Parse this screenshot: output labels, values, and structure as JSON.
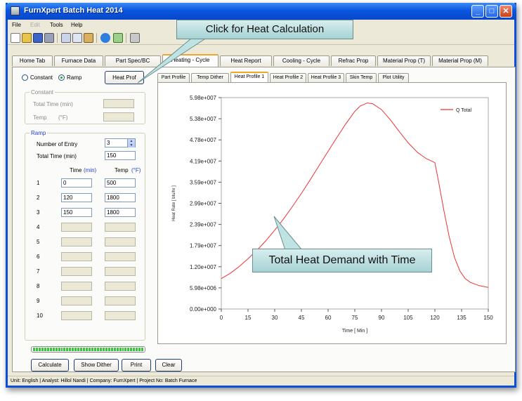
{
  "window": {
    "title": "FurnXpert Batch Heat 2014"
  },
  "menu": [
    {
      "label": "File",
      "disabled": false
    },
    {
      "label": "Edit",
      "disabled": true
    },
    {
      "label": "Tools",
      "disabled": false
    },
    {
      "label": "Help",
      "disabled": false
    }
  ],
  "main_tabs": [
    "Home Tab",
    "Furnace Data",
    "Part Spec/BC",
    "Heating - Cycle",
    "Heat Report",
    "Cooling - Cycle",
    "Refrac Prop",
    "Material Prop (T)",
    "Material Prop (M)"
  ],
  "active_main_tab": "Heating - Cycle",
  "left": {
    "radio_constant": "Constant",
    "radio_ramp": "Ramp",
    "heat_prof_button": "Heat Prof",
    "constant_group": "Constant",
    "total_time_label": "Total Time (min)",
    "temp_label": "Temp",
    "temp_unit": "(°F)",
    "ramp_group": "Ramp",
    "number_of_entry_label": "Number of Entry",
    "number_of_entry_value": "3",
    "ramp_total_time_label": "Total Time (min)",
    "ramp_total_time_value": "150",
    "col_time": "Time",
    "col_time_unit": "(min)",
    "col_temp": "Temp",
    "col_temp_unit": "(°F)",
    "rows": [
      {
        "n": "1",
        "time": "0",
        "temp": "500"
      },
      {
        "n": "2",
        "time": "120",
        "temp": "1800"
      },
      {
        "n": "3",
        "time": "150",
        "temp": "1800"
      },
      {
        "n": "4",
        "time": "",
        "temp": ""
      },
      {
        "n": "5",
        "time": "",
        "temp": ""
      },
      {
        "n": "6",
        "time": "",
        "temp": ""
      },
      {
        "n": "7",
        "time": "",
        "temp": ""
      },
      {
        "n": "8",
        "time": "",
        "temp": ""
      },
      {
        "n": "9",
        "time": "",
        "temp": ""
      },
      {
        "n": "10",
        "time": "",
        "temp": ""
      }
    ]
  },
  "bottom_buttons": {
    "calculate": "Calculate",
    "show_dither": "Show Dither",
    "print": "Print",
    "clear": "Clear"
  },
  "progress": 1.0,
  "sub_tabs": [
    "Part Profile",
    "Temp Dither",
    "Heat Profile 1",
    "Heat Profile 2",
    "Heat Profile 3",
    "Skin Temp",
    "Plot Utility"
  ],
  "active_sub_tab": "Heat Profile 1",
  "status_bar": "Unit: English  | Analyst: Hillol Nandi  | Company: FurnXpert  | Project No: Batch Furnace",
  "callouts": {
    "top": "Click for Heat Calculation",
    "chart": "Total Heat Demand with Time"
  },
  "colors": {
    "series": "#ee3333",
    "accent_tab": "#f0a628",
    "title_bar": "#0a56e0",
    "callout": "#bfe2e3"
  },
  "chart_data": {
    "type": "line",
    "xlabel": "Time [ Min ]",
    "ylabel": "Heat Rate [ btu/hr ]",
    "xlim": [
      0,
      150
    ],
    "ylim": [
      0,
      59800000
    ],
    "x_ticks": [
      "0",
      "15",
      "30",
      "45",
      "60",
      "75",
      "90",
      "105",
      "120",
      "135",
      "150"
    ],
    "y_ticks": [
      "0.00e+000",
      "5.98e+006",
      "1.20e+007",
      "1.79e+007",
      "2.39e+007",
      "2.99e+007",
      "3.59e+007",
      "4.19e+007",
      "4.78e+007",
      "5.38e+007",
      "5.98e+007"
    ],
    "legend_position": "top-right",
    "series": [
      {
        "name": "Q Total",
        "x": [
          0,
          5,
          10,
          15,
          20,
          25,
          30,
          35,
          40,
          45,
          50,
          55,
          60,
          65,
          70,
          75,
          78,
          82,
          85,
          90,
          95,
          100,
          105,
          110,
          115,
          120,
          122,
          125,
          128,
          131,
          134,
          137,
          140,
          145,
          150
        ],
        "y": [
          8600000,
          10100000,
          12000000,
          14200000,
          16600000,
          19300000,
          22300000,
          25500000,
          29000000,
          32700000,
          36600000,
          40600000,
          44600000,
          48600000,
          52400000,
          55900000,
          57400000,
          58300000,
          58100000,
          56400000,
          53500000,
          50200000,
          47000000,
          44400000,
          42600000,
          41400000,
          36200000,
          28000000,
          20500000,
          14600000,
          10800000,
          8600000,
          7500000,
          6600000,
          6100000
        ]
      }
    ]
  }
}
